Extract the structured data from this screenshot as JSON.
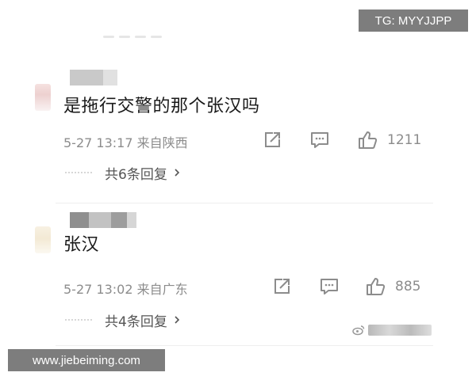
{
  "comments": [
    {
      "text": "是拖行交警的那个张汉吗",
      "meta": "5-27 13:17  来自陕西",
      "likes": "1211",
      "replies": "共6条回复"
    },
    {
      "text": "张汉",
      "meta": "5-27 13:02  来自广东",
      "likes": "885",
      "replies": "共4条回复"
    }
  ],
  "icons": {
    "share": "share-icon",
    "reply": "comment-icon",
    "like": "thumbs-up-icon",
    "chevron": "chevron-right-icon"
  },
  "watermarks": {
    "top_right": "TG: MYYJJPP",
    "bottom_left": "www.jiebeiming.com"
  },
  "colors": {
    "text": "#1a1a1a",
    "meta": "#8c8c8c",
    "watermark_bg": "#606060"
  }
}
